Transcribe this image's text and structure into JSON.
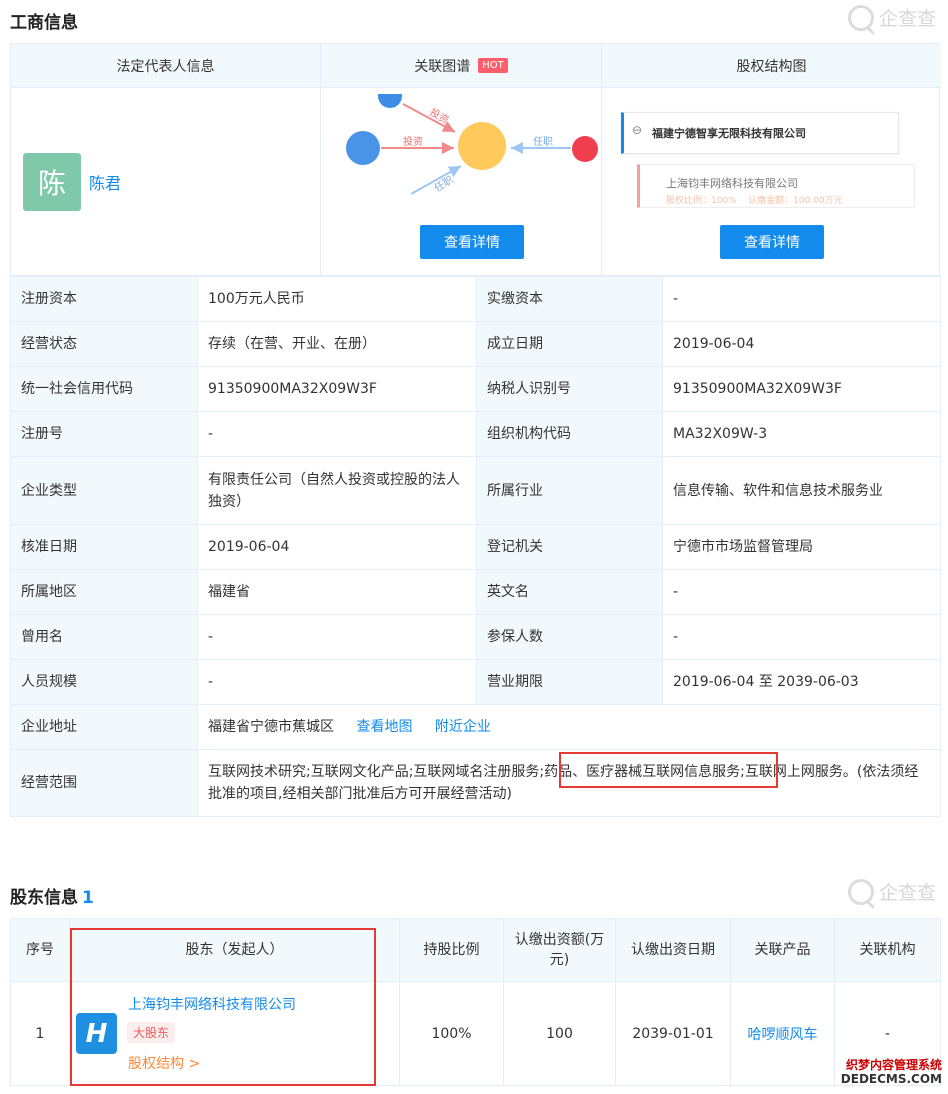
{
  "section1": {
    "title": "工商信息",
    "watermark": "企查查"
  },
  "top": {
    "legal_rep_header": "法定代表人信息",
    "relation_header": "关联图谱",
    "hot": "HOT",
    "equity_header": "股权结构图",
    "avatar_char": "陈",
    "rep_name": "陈君",
    "graph_labels": {
      "invest1": "投资",
      "invest2": "投资",
      "role1": "任职",
      "role2": "任职"
    },
    "equity_company": "福建宁德智享无限科技有限公司",
    "equity_sub": "上海钧丰网络科技有限公司",
    "equity_sub_detail": "股权比例：100%    认缴金额：100.00万元",
    "view_detail_1": "查看详情",
    "view_detail_2": "查看详情"
  },
  "info": {
    "rows": [
      [
        "注册资本",
        "100万元人民币",
        "实缴资本",
        "-"
      ],
      [
        "经营状态",
        "存续（在营、开业、在册）",
        "成立日期",
        "2019-06-04"
      ],
      [
        "统一社会信用代码",
        "91350900MA32X09W3F",
        "纳税人识别号",
        "91350900MA32X09W3F"
      ],
      [
        "注册号",
        "-",
        "组织机构代码",
        "MA32X09W-3"
      ],
      [
        "企业类型",
        "有限责任公司（自然人投资或控股的法人独资）",
        "所属行业",
        "信息传输、软件和信息技术服务业"
      ],
      [
        "核准日期",
        "2019-06-04",
        "登记机关",
        "宁德市市场监督管理局"
      ],
      [
        "所属地区",
        "福建省",
        "英文名",
        "-"
      ],
      [
        "曾用名",
        "-",
        "参保人数",
        "-"
      ],
      [
        "人员规模",
        "-",
        "营业期限",
        "2019-06-04 至 2039-06-03"
      ]
    ],
    "address_label": "企业地址",
    "address": "福建省宁德市蕉城区",
    "view_map": "查看地图",
    "nearby": "附近企业",
    "scope_label": "经营范围",
    "scope": "互联网技术研究;互联网文化产品;互联网域名注册服务;药品、医疗器械互联网信息服务;互联网上网服务。(依法须经批准的项目,经相关部门批准后方可开展经营活动)"
  },
  "section2": {
    "title": "股东信息",
    "count": "1",
    "watermark": "企查查"
  },
  "shareholders": {
    "headers": [
      "序号",
      "股东（发起人）",
      "持股比例",
      "认缴出资额(万元)",
      "认缴出资日期",
      "关联产品",
      "关联机构"
    ],
    "row": {
      "index": "1",
      "name": "上海钧丰网络科技有限公司",
      "tag": "大股东",
      "struct_link": "股权结构 >",
      "ratio": "100%",
      "amount": "100",
      "date": "2039-01-01",
      "product": "哈啰顺风车",
      "org": "-"
    }
  },
  "footer": {
    "line1": "织梦内容管理系统",
    "line2": "DEDECMS.COM"
  }
}
